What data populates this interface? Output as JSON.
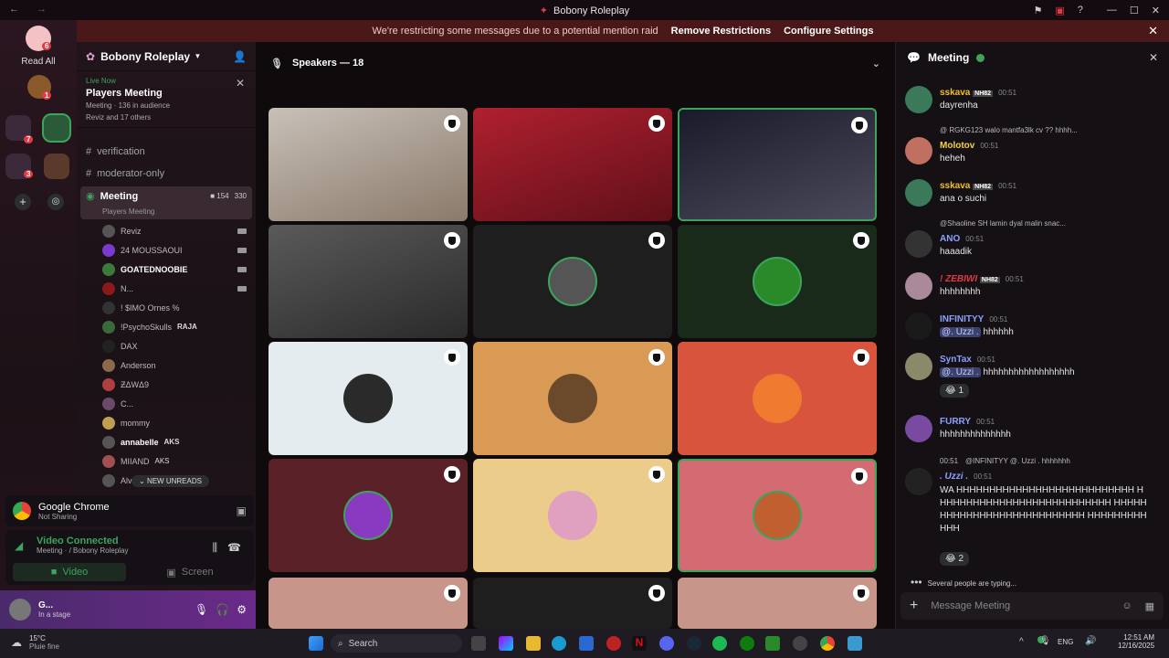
{
  "window": {
    "title": "Bobony Roleplay"
  },
  "notice": {
    "text": "We're restricting some messages due to a potential mention raid",
    "action1": "Remove Restrictions",
    "action2": "Configure Settings"
  },
  "rail": {
    "read_all": "Read All",
    "badges": [
      "6",
      "1",
      "7",
      "3"
    ]
  },
  "server": {
    "name": "Bobony Roleplay"
  },
  "live": {
    "label": "Live Now",
    "title": "Players Meeting",
    "meta": "Meeting · 136 in audience",
    "people": "Reviz and 17 others"
  },
  "channels": [
    {
      "name": "verification"
    },
    {
      "name": "moderator-only"
    }
  ],
  "meeting": {
    "name": "Meeting",
    "sub": "Players Meeting",
    "count1": "154",
    "count2": "330"
  },
  "members": [
    "Reviz",
    "24 MOUSSAOUI",
    "GOATEDNOOBIE",
    "N...",
    "! $IMO Ornes %",
    "!PsychoSkulls",
    "DAX",
    "Anderson",
    "ƵΔWΔ9",
    "C...",
    "mommy",
    "annabelle",
    "MIIAND",
    "Alvaro"
  ],
  "member_tags": {
    "psycho": "RAJA",
    "annabelle": "AKS",
    "miiand": "AKS"
  },
  "new_unreads": "NEW UNREADS",
  "share": {
    "app": "Google Chrome",
    "status": "Not Sharing"
  },
  "voice": {
    "status": "Video Connected",
    "where": "Meeting · / Bobony Roleplay",
    "video": "Video",
    "screen": "Screen"
  },
  "user": {
    "name": "G...",
    "status": "In a stage"
  },
  "stage": {
    "title": "Speakers — 18"
  },
  "chat": {
    "title": "Meeting",
    "messages": [
      {
        "name": "sskava",
        "tag": "NH82",
        "time": "00:51",
        "text": "dayrenha",
        "color": "#f0c020"
      },
      {
        "reply": "@ RGKG123 walo mantfa3lk cv ?? hhhh...",
        "name": "Molotov",
        "time": "00:51",
        "text": "heheh",
        "color": "#f5d142"
      },
      {
        "name": "sskava",
        "tag": "NH82",
        "time": "00:51",
        "text": "ana o suchi",
        "color": "#f0c020"
      },
      {
        "reply": "@Shaoline SH lamin dyal malin snac...",
        "name": "ANO",
        "time": "00:51",
        "text": "haaadik",
        "color": "#8aa0ff"
      },
      {
        "name": "! ZEBIWI",
        "tag": "NH82",
        "time": "00:51",
        "text": "hhhhhhhh",
        "color": "#e23a43"
      },
      {
        "name": "INFINITYY",
        "time": "00:51",
        "mention": "@. Uzzi .",
        "text": "hhhhhh",
        "color": "#8aa0ff"
      },
      {
        "name": "SynTax",
        "time": "00:51",
        "mention": "@. Uzzi .",
        "text": "hhhhhhhhhhhhhhhhhh",
        "color": "#8aa0ff",
        "reaction": "1"
      },
      {
        "name": "FURRY",
        "time": "00:51",
        "text": "hhhhhhhhhhhhhh",
        "color": "#8aa0ff"
      },
      {
        "reply": "@INFINITYY @. Uzzi . hhhhhhh",
        "name": ". Uzzi .",
        "time": "00:51",
        "text": "WA HHHHHHHHHHHHHHHHHHHHHHHHHHH HHHHHHHHHHHHHHHHHHHHHHHHHHH HHHHHHHHHHHHHHHHHHHHHHHHHHH HHHHHHHHHHHH",
        "color": "#8aa0ff",
        "reaction": "2",
        "reply_time": "00:51"
      }
    ],
    "typing": "Several people are typing...",
    "placeholder": "Message Meeting"
  },
  "taskbar": {
    "temp": "15°C",
    "weather": "Pluie fine",
    "search": "Search",
    "lang": "ENG",
    "time": "12:51 AM",
    "date": "12/16/2025"
  }
}
